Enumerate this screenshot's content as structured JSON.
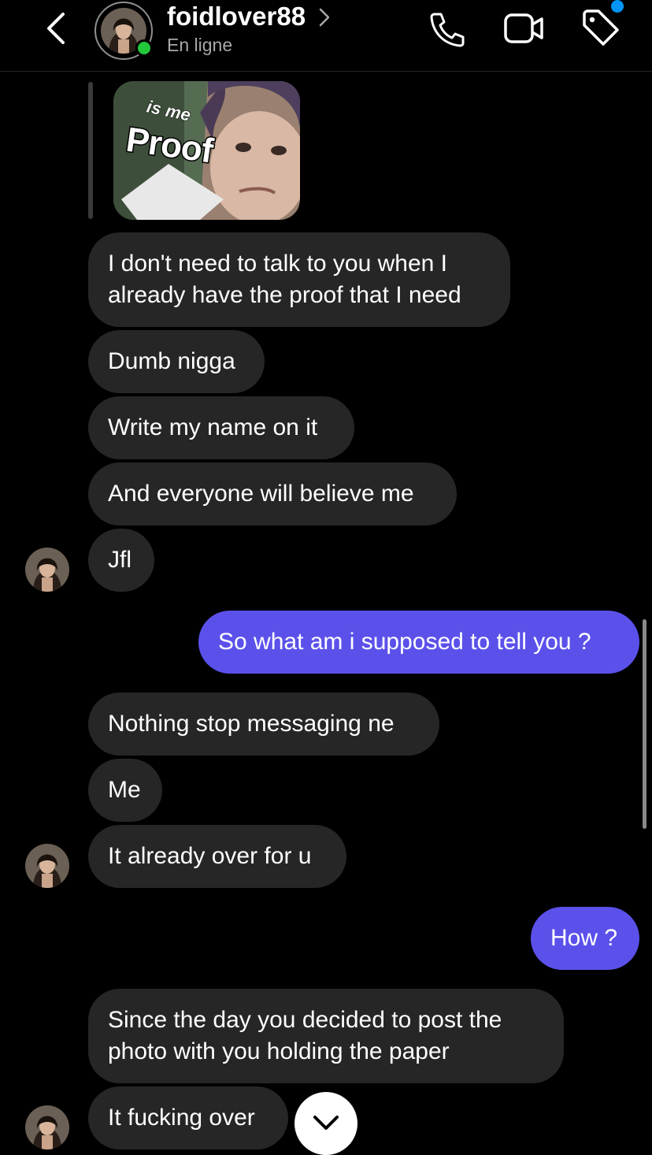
{
  "header": {
    "username": "foidlover88",
    "status": "En ligne",
    "icons": [
      "back-chevron-icon",
      "chevron-right-icon",
      "phone-icon",
      "video-camera-icon",
      "tag-icon"
    ],
    "colors": {
      "online": "#22c83a",
      "notification": "#0095f6"
    }
  },
  "replied_photo": {
    "overlay_small": "is me",
    "overlay_big": "Proof"
  },
  "messages": [
    {
      "from": "them",
      "text": "I don't need to talk to you when I already have the proof that I need",
      "lines": [
        "I don't need to talk to you when I",
        "already have the proof that I need"
      ]
    },
    {
      "from": "them",
      "text": "Dumb nigga"
    },
    {
      "from": "them",
      "text": "Write my name on it"
    },
    {
      "from": "them",
      "text": "And everyone will believe me"
    },
    {
      "from": "them",
      "text": "Jfl"
    },
    {
      "from": "me",
      "text": "So what am i supposed to tell you ?"
    },
    {
      "from": "them",
      "text": "Nothing stop messaging ne"
    },
    {
      "from": "them",
      "text": "Me"
    },
    {
      "from": "them",
      "text": "It already over for u"
    },
    {
      "from": "me",
      "text": "How ?"
    },
    {
      "from": "them",
      "text": "Since the day you decided to post the photo with you holding the paper",
      "lines": [
        "Since the day you decided to post the",
        "photo with you holding the paper"
      ]
    },
    {
      "from": "them",
      "text": "It fucking over"
    }
  ],
  "colors": {
    "background": "#000000",
    "incoming_bubble": "#262626",
    "outgoing_bubble": "#5b51ea"
  }
}
